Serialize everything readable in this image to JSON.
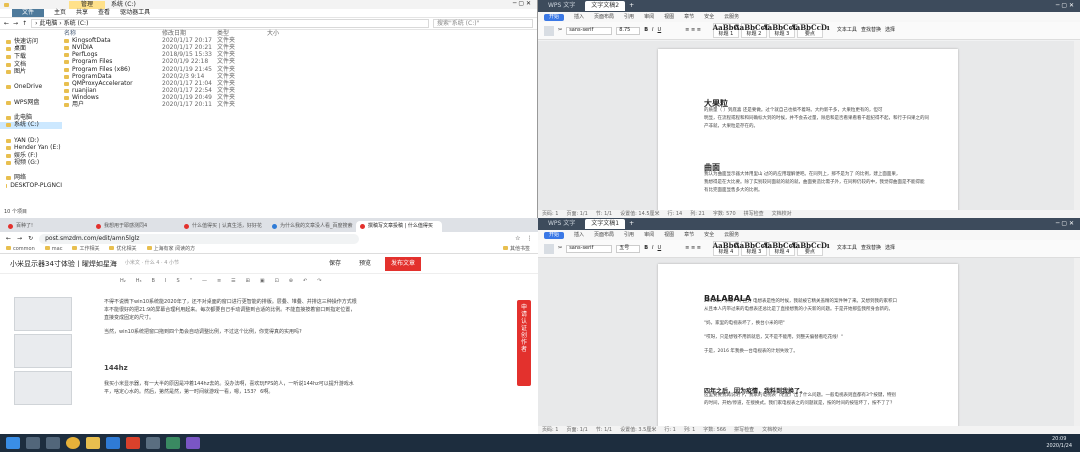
{
  "explorer": {
    "ribbon_tab_active": "管理",
    "title": "系统 (C:)",
    "tabs": [
      "文件",
      "主页",
      "共享",
      "查看",
      "驱动器工具"
    ],
    "path": "› 此电脑 › 系统 (C:)",
    "search_placeholder": "搜索\"系统 (C:)\"",
    "columns": [
      "名称",
      "修改日期",
      "类型",
      "大小"
    ],
    "nav": [
      {
        "label": "快速访问",
        "sel": false
      },
      {
        "label": "桌面",
        "sel": false
      },
      {
        "label": "下载",
        "sel": false
      },
      {
        "label": "文档",
        "sel": false
      },
      {
        "label": "图片",
        "sel": false
      },
      {
        "label": "",
        "sel": false
      },
      {
        "label": "OneDrive",
        "sel": false
      },
      {
        "label": "",
        "sel": false
      },
      {
        "label": "WPS网盘",
        "sel": false
      },
      {
        "label": "",
        "sel": false
      },
      {
        "label": "此电脑",
        "sel": false
      },
      {
        "label": "系统 (C:)",
        "sel": true
      },
      {
        "label": "",
        "sel": false
      },
      {
        "label": "YAN (D:)",
        "sel": false
      },
      {
        "label": "Hender Yan (E:)",
        "sel": false
      },
      {
        "label": "娱乐 (F:)",
        "sel": false
      },
      {
        "label": "视频 (G:)",
        "sel": false
      },
      {
        "label": "",
        "sel": false
      },
      {
        "label": "网络",
        "sel": false
      },
      {
        "label": "DESKTOP-PLGNCI",
        "sel": false
      }
    ],
    "files": [
      {
        "name": "KingsoftData",
        "date": "2020/1/17 20:17",
        "type": "文件夹"
      },
      {
        "name": "NVIDIA",
        "date": "2020/1/17 20:21",
        "type": "文件夹"
      },
      {
        "name": "PerfLogs",
        "date": "2018/9/15 15:33",
        "type": "文件夹"
      },
      {
        "name": "Program Files",
        "date": "2020/1/9 22:18",
        "type": "文件夹"
      },
      {
        "name": "Program Files (x86)",
        "date": "2020/1/19 21:45",
        "type": "文件夹"
      },
      {
        "name": "ProgramData",
        "date": "2020/2/3 9:14",
        "type": "文件夹"
      },
      {
        "name": "QMProxyAccelerator",
        "date": "2020/1/17 21:04",
        "type": "文件夹"
      },
      {
        "name": "ruanjian",
        "date": "2020/1/17 22:54",
        "type": "文件夹"
      },
      {
        "name": "Windows",
        "date": "2020/1/19 20:49",
        "type": "文件夹"
      },
      {
        "name": "用户",
        "date": "2020/1/17 20:11",
        "type": "文件夹"
      }
    ],
    "status": "10 个项目"
  },
  "wps1": {
    "tabs": [
      "WPS 文字",
      "文字文稿2"
    ],
    "menu": [
      "开始",
      "插入",
      "页面布局",
      "引用",
      "审阅",
      "视图",
      "章节",
      "安全",
      "云服务"
    ],
    "font": "sans-serif",
    "size": "8.75",
    "styles": [
      {
        "s": "AaBbC",
        "l": "标题 1"
      },
      {
        "s": "AaBbCcDı",
        "l": "标题 2"
      },
      {
        "s": "AaBbCcDı",
        "l": "标题 3"
      },
      {
        "s": "AaBbCcDı",
        "l": "要点"
      }
    ],
    "right_tools": [
      "文本工具",
      "查找替换",
      "选择"
    ],
    "doc": {
      "h1": "大果粒",
      "p1": [
        "                     的质量（            ）到底喜               还是要做。过个就自己也搞不着呀。大约新千多，大果粒更有的，但可",
        "明显，在流程或程和和同确标大到的时候，并不会去过量，除后和是否看果看看千超纪得不起，和行于归果之的同",
        "产非就，大果粒是存在的。"
      ],
      "h2": "曲面",
      "p2": [
        "我认为曲面显示器大体用里山            过的的应用理解便吧。在同列上，那不是为了             的比例，建上面面果，",
        "我想得是在大比要。除了实别较同面就的就的就，曲面要造比需子外，在同称仍较的中，我觉得曲面是不能得能",
        "有比完面面显售多大的比例。"
      ]
    },
    "status": [
      "页码: 1",
      "页面: 1/1",
      "节: 1/1",
      "设置值: 14.5厘米",
      "行: 14",
      "列: 21",
      "字数: 570",
      "拼写检查",
      "文档校对"
    ]
  },
  "wps2": {
    "tabs": [
      "WPS 文字",
      "文字文稿1"
    ],
    "menu": [
      "开始",
      "插入",
      "页面布局",
      "引用",
      "审阅",
      "视图",
      "章节",
      "安全",
      "云服务"
    ],
    "font": "sans-serif",
    "size": "五号",
    "styles": [
      {
        "s": "AaBbC",
        "l": "标题 4"
      },
      {
        "s": "AaBbCcDı",
        "l": "标题 3"
      },
      {
        "s": "AaBbCcDı",
        "l": "标题 4"
      },
      {
        "s": "AaBbCcDı",
        "l": "要点"
      }
    ],
    "right_tools": [
      "文本工具",
      "查找替换",
      "选择"
    ],
    "doc": {
      "h1": "BALABALA",
      "p1": [
        "2016年，米家! 叫 且力 电想表是性的时候，我就被它精关盖精的案件种了来。又想到我的家积口",
        "从且本人内带过来的电想表还总比是了直接想我的小天新的问题。于是开始那些我所身会新的。"
      ],
      "p2": "\"妈，家里的电视表坏了，换台小米的吧\"",
      "p3": "\"哎呀，只是想钱不用新就后，又不是不能用，到整天偏替看吃花线！\"",
      "p4": "于是，2016 年我换一台电视表的计划失败了。",
      "h2": "四年之后，因为疫情，我料到我换了。",
      "p5": [
        "这里要要我再说明下，我家的电视表（老配）出了什么问题。一般电视表则直都有3个按键，特别",
        "的时间，开始/停道，在接换式。我们家电视表之的问题就是，按的时间的按钮坏了，按不了了？"
      ]
    },
    "status": [
      "页码: 1",
      "页面: 1/1",
      "节: 1/1",
      "设置值: 3.5厘米",
      "行: 1",
      "列: 1",
      "字数: 566",
      "拼写检查",
      "文档校对"
    ]
  },
  "browser": {
    "tabs": [
      "百种了!",
      "我想用于耶感测同4",
      "什么值得买 | 认真生活，好好花",
      "为什么我的文章没人看_百度搜索",
      "撰稿写文章投稿 | 什么值得买"
    ],
    "url": "post.smzdm.com/edit/amn5lglz",
    "bookmarks": [
      "common",
      "mac",
      "工作相关",
      "优化相关",
      "上海有家 阅读的方",
      "其他书签"
    ],
    "title": "小米显示器34寸体验丨曜焊如星海",
    "meta": "小米文   · 什么 4 · 4 小节",
    "save": "保存",
    "preview": "预览",
    "publish": "发布文章",
    "toolbar": [
      "H₂",
      "H₃",
      "B",
      "I",
      "S",
      "\"",
      "—",
      "≡",
      "☰",
      "⊞",
      "▣",
      "⊡",
      "⊕",
      "↶",
      "↷"
    ],
    "p1": [
      "不得不说微下win10系统能2020年了，还不对桌面的窗口进行更智能的排版。层叠、堆叠、并排这三种操作方式根",
      "本不能很好的把21:9的屏幕合理利用起来。每次都要自己手动调整到合适的比例。不能直接按着窗口到指定位置，",
      "直接变成固定的尺寸。"
    ],
    "p2": "当然，win10系统把窗口拖到四个角会自动调整比例，不过这个比例，你觉得真的实用吗?",
    "h2": "144hz",
    "p3": [
      "我买小米显示器，有一大半的原因是冲着144hz去的。没办法啊，喜欢玩FPS的人，一听说144hz可以提升游戏水",
      "平，啥定心水的。然后，第然是然，第一时间就游戏一看，嗯，153？ 6啊。"
    ],
    "side": "申请认证创作者"
  },
  "taskbar": {
    "time": "20:09",
    "date": "2020/1/24"
  }
}
